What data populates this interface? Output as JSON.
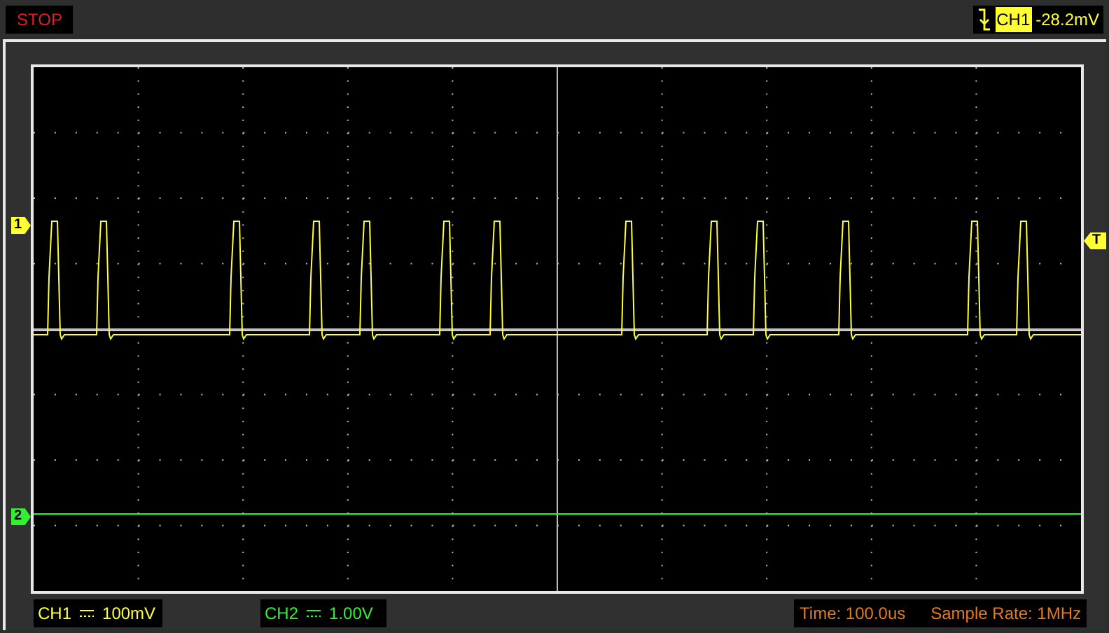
{
  "status": "STOP",
  "trigger": {
    "channel": "CH1",
    "reading": "-28.2mV",
    "marker": "T"
  },
  "channel_markers": [
    {
      "label": "1",
      "color": "#ffff33"
    },
    {
      "label": "2",
      "color": "#33ee33"
    }
  ],
  "channels": [
    {
      "name": "CH1",
      "scale": "100mV",
      "color": "#ffff33"
    },
    {
      "name": "CH2",
      "scale": "1.00V",
      "color": "#33ee33"
    }
  ],
  "time": "Time: 100.0us",
  "sample_rate": "Sample Rate: 1MHz"
}
